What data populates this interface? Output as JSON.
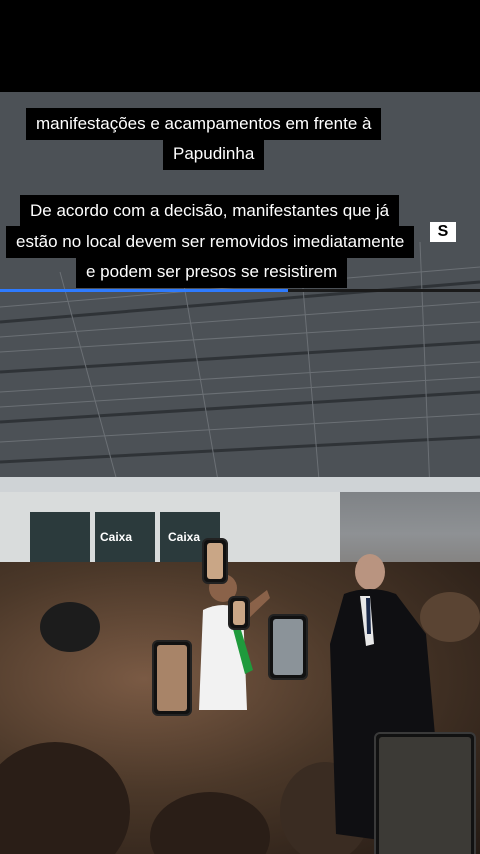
{
  "captions": {
    "line1": "manifestações e acampamentos em frente à",
    "line2": "Papudinha",
    "line3": "De acordo com a decisão, manifestantes que já",
    "line4": "estão no local devem ser removidos imediatamente",
    "line5": "e podem ser presos se resistirem"
  },
  "video": {
    "progress_percent": 60,
    "signs": [
      "Caixa",
      "Caixa"
    ]
  },
  "colors": {
    "progress": "#2e7bff",
    "caption_bg": "#000000"
  }
}
